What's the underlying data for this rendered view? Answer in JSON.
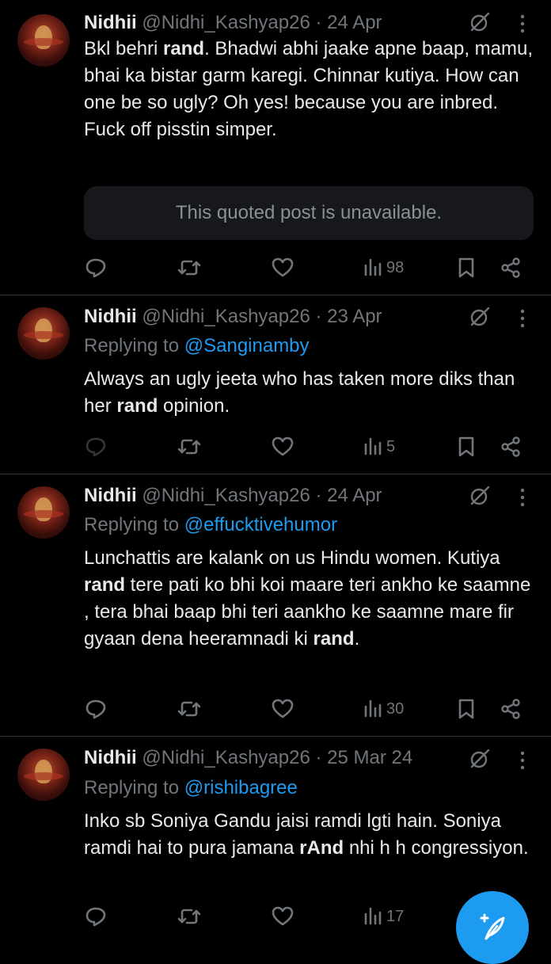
{
  "tweets": [
    {
      "name": "Nidhii",
      "handle": "@Nidhi_Kashyap26",
      "date": "· 24 Apr",
      "reply_prefix": "",
      "reply_to": "",
      "text": [
        {
          "t": "Bkl behri "
        },
        {
          "b": "rand"
        },
        {
          "t": ". Bhadwi abhi jaake apne baap, mamu, bhai ka bistar garm karegi. Chinnar kutiya. How can one be so ugly? Oh yes! because you are inbred.  Fuck off pisstin simper."
        }
      ],
      "quote": "This quoted post is unavailable.",
      "views": "98"
    },
    {
      "name": "Nidhii",
      "handle": "@Nidhi_Kashyap26",
      "date": "· 23 Apr",
      "reply_prefix": "Replying to ",
      "reply_to": "@Sanginamby",
      "text": [
        {
          "t": "Always an ugly jeeta who has taken more diks than her "
        },
        {
          "b": "rand"
        },
        {
          "t": " opinion."
        }
      ],
      "quote": "",
      "views": "5"
    },
    {
      "name": "Nidhii",
      "handle": "@Nidhi_Kashyap26",
      "date": "· 24 Apr",
      "reply_prefix": "Replying to ",
      "reply_to": "@effucktivehumor",
      "text": [
        {
          "t": "Lunchattis are kalank on us Hindu women. Kutiya "
        },
        {
          "b": "rand"
        },
        {
          "t": " tere pati ko bhi koi maare teri ankho ke saamne , tera bhai baap bhi teri aankho ke saamne mare fir gyaan dena heeramnadi ki "
        },
        {
          "b": "rand"
        },
        {
          "t": "."
        }
      ],
      "quote": "",
      "views": "30"
    },
    {
      "name": "Nidhii",
      "handle": "@Nidhi_Kashyap26",
      "date": "· 25 Mar 24",
      "reply_prefix": "Replying to ",
      "reply_to": "@rishibagree",
      "text": [
        {
          "t": "Inko sb Soniya  Gandu jaisi ramdi lgti hain. Soniya ramdi hai to pura jamana "
        },
        {
          "b": "rAnd"
        },
        {
          "t": " nhi h h congressiyon."
        }
      ],
      "quote": "",
      "views": "17"
    }
  ],
  "icons": {
    "reply": "reply-icon",
    "retweet": "retweet-icon",
    "like": "heart-icon",
    "views": "views-icon",
    "bookmark": "bookmark-icon",
    "share": "share-icon",
    "grok": "grok-icon",
    "more": "more-icon",
    "compose": "compose-icon"
  },
  "colors": {
    "background": "#000000",
    "text": "#e7e9ea",
    "muted": "#71767b",
    "link": "#1d9bf0",
    "quote_bg": "#16181c",
    "fab": "#1d9bf0"
  }
}
